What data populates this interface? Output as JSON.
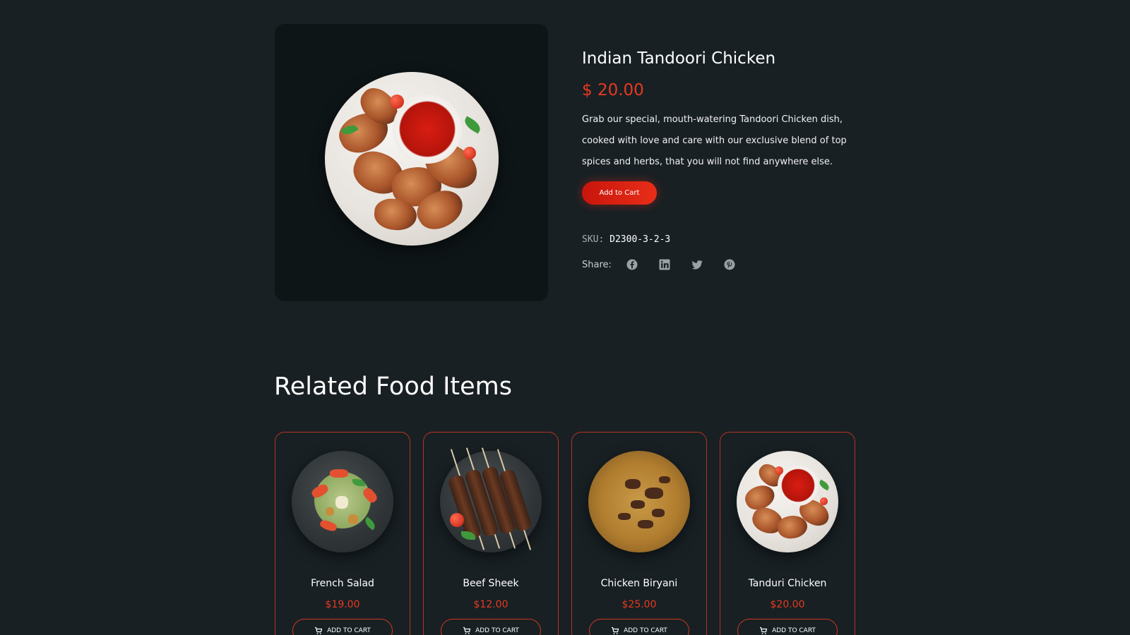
{
  "product": {
    "title": "Indian Tandoori Chicken",
    "price": "$ 20.00",
    "description": "Grab our special, mouth-watering Tandoori Chicken dish, cooked with love and care with our exclusive blend of top spices and herbs, that you will not find anywhere else.",
    "add_to_cart_label": "Add to Cart",
    "sku_label": "SKU:",
    "sku_value": "D2300-3-2-3",
    "share_label": "Share:",
    "share_icons": [
      "facebook-icon",
      "linkedin-icon",
      "twitter-icon",
      "pinterest-icon"
    ]
  },
  "related": {
    "heading": "Related Food Items",
    "button_label": "ADD TO CART",
    "items": [
      {
        "name": "French Salad",
        "price": "$19.00"
      },
      {
        "name": "Beef Sheek",
        "price": "$12.00"
      },
      {
        "name": "Chicken Biryani",
        "price": "$25.00"
      },
      {
        "name": "Tanduri Chicken",
        "price": "$20.00"
      }
    ]
  },
  "colors": {
    "background": "#182024",
    "panel": "#0e1517",
    "accent": "#e8391f",
    "card_border": "#b9321f"
  }
}
